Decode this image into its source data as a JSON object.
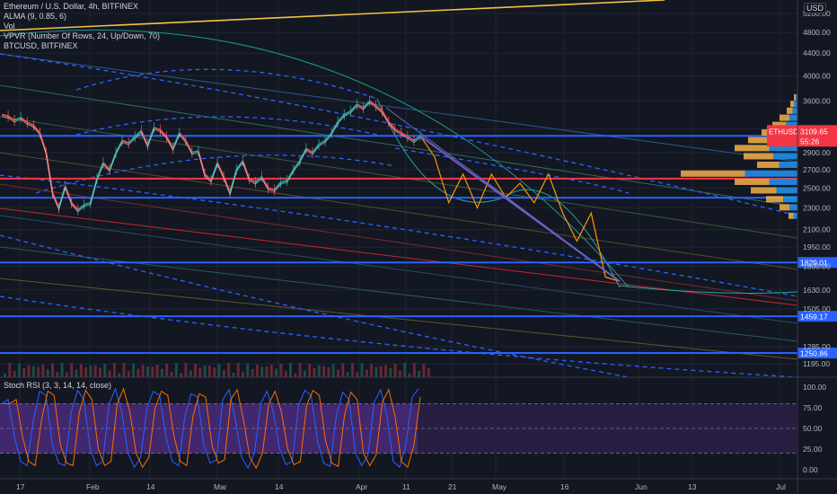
{
  "legend": {
    "title": "Ethereum / U.S. Dollar, 4h, BITFINEX",
    "ind1": "ALMA (9, 0.85, 6)",
    "ind2": "Vol",
    "ind3": "VPVR (Number Of Rows, 24, Up/Down, 70)",
    "ind4": "BTCUSD, BITFINEX"
  },
  "currency": "USD",
  "rsi_legend": "Stoch RSI (3, 3, 14, 14, close)",
  "colors": {
    "bg": "#131722",
    "up": "#26a69a",
    "down": "#ef5350",
    "blue_line": "#2962ff",
    "red_line": "#f23645",
    "orange": "#ff9800",
    "btc": "#f5c242",
    "purple": "#7e57c2",
    "rsi_band": "#4a2a7a",
    "vpvr_up": "#2196f3",
    "vpvr_down": "#f4b04a"
  },
  "chart_data": {
    "type": "line",
    "y_scale": "log",
    "ylim": [
      1130,
      5500
    ],
    "price_ticks": [
      {
        "v": 5200,
        "t": "5200.00"
      },
      {
        "v": 4800,
        "t": "4800.00"
      },
      {
        "v": 4400,
        "t": "4400.00"
      },
      {
        "v": 4000,
        "t": "4000.00"
      },
      {
        "v": 3600,
        "t": "3600.00"
      },
      {
        "v": 3200,
        "t": "3200.00"
      },
      {
        "v": 2900,
        "t": "2900.00"
      },
      {
        "v": 2700,
        "t": "2700.00"
      },
      {
        "v": 2500,
        "t": "2500.00"
      },
      {
        "v": 2300,
        "t": "2300.00"
      },
      {
        "v": 2100,
        "t": "2100.00"
      },
      {
        "v": 1950,
        "t": "1950.00"
      },
      {
        "v": 1800,
        "t": "1800.00"
      },
      {
        "v": 1630,
        "t": "1630.00"
      },
      {
        "v": 1505,
        "t": "1505.00"
      },
      {
        "v": 1285,
        "t": "1285.00"
      },
      {
        "v": 1195,
        "t": "1195.00"
      }
    ],
    "x_ticks": [
      "17",
      "Feb",
      "14",
      "Mar",
      "14",
      "Apr",
      "11",
      "21",
      "May",
      "16",
      "Jun",
      "13",
      "Jul"
    ],
    "price_label": {
      "symbol": "ETHUSD",
      "price": "3109.65",
      "countdown": "55:26"
    },
    "horizontal_levels": [
      {
        "value": 3110,
        "label": ""
      },
      {
        "value": 2600,
        "label": ""
      },
      {
        "value": 2400,
        "label": ""
      },
      {
        "value": 1829.01,
        "label": "1829.01"
      },
      {
        "value": 1459.17,
        "label": "1459.17"
      },
      {
        "value": 1250.86,
        "label": "1250.86"
      }
    ],
    "price_path": [
      3400,
      3380,
      3320,
      3360,
      3290,
      3250,
      3150,
      2900,
      2450,
      2300,
      2520,
      2350,
      2280,
      2330,
      2350,
      2600,
      2780,
      2700,
      2900,
      3050,
      3020,
      3100,
      3180,
      2990,
      3220,
      3190,
      3100,
      2950,
      3150,
      3050,
      2900,
      2920,
      2650,
      2580,
      2780,
      2620,
      2450,
      2700,
      2800,
      2600,
      2560,
      2620,
      2500,
      2480,
      2560,
      2580,
      2700,
      2800,
      2950,
      2900,
      3000,
      3050,
      3150,
      3300,
      3400,
      3450,
      3550,
      3500,
      3600,
      3530,
      3450,
      3300,
      3200,
      3150,
      3100,
      3050,
      3110
    ],
    "projection_path": [
      3110,
      2850,
      2350,
      2650,
      2300,
      2650,
      2400,
      2550,
      2350,
      2650,
      2250,
      2000,
      2250,
      1720,
      1690
    ],
    "stoch_rsi": {
      "ylim": [
        0,
        100
      ],
      "ticks": [
        "100.00",
        "75.00",
        "50.00",
        "25.00",
        "0.00"
      ],
      "band": [
        20,
        80
      ],
      "k": [
        80,
        85,
        40,
        10,
        5,
        60,
        95,
        90,
        30,
        8,
        5,
        70,
        96,
        85,
        25,
        5,
        10,
        80,
        98,
        70,
        20,
        3,
        15,
        75,
        95,
        90,
        40,
        10,
        5,
        65,
        92,
        88,
        30,
        8,
        12,
        85,
        97,
        60,
        15,
        2,
        20,
        80,
        95,
        70,
        25,
        6,
        10,
        78,
        96,
        90,
        35,
        8,
        4,
        66,
        94,
        85,
        20,
        5,
        18,
        82,
        97,
        65,
        10,
        3,
        30,
        88,
        98
      ]
    }
  }
}
